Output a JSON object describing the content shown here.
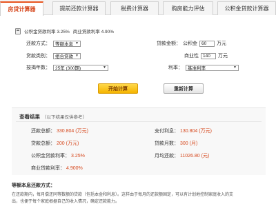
{
  "tabs": [
    {
      "label": "房贷计算器"
    },
    {
      "label": "提前还款计算器"
    },
    {
      "label": "税费计算器"
    },
    {
      "label": "购房能力评估"
    },
    {
      "label": "公积金贷款计算器"
    }
  ],
  "rates": {
    "fund_label": "公积金贷款利率",
    "fund_value": "3.25%",
    "commercial_label": "商业贷款利率",
    "commercial_value": "4.90%"
  },
  "form": {
    "repay_method_label": "还款方式：",
    "repay_method_value": "等额本息",
    "loan_type_label": "贷款类别：",
    "loan_type_value": "组合贷款",
    "years_label": "按揭年数：",
    "years_value": "25年 (300期)",
    "loan_amount_label": "贷款金额：",
    "fund_part_label": "公积金",
    "fund_part_value": "60",
    "fund_part_unit": "万元",
    "commercial_part_label": "商业性",
    "commercial_part_value": "140",
    "commercial_part_unit": "万元",
    "rate_label": "利率：",
    "rate_value": "基准利率"
  },
  "buttons": {
    "calculate": "开始计算",
    "reset": "重新计算"
  },
  "result": {
    "title": "查看结果",
    "note": "（以下结果仅供参考）",
    "total_repay_label": "还款总额：",
    "total_repay_value": "330.804 (万元)",
    "interest_label": "支付利息：",
    "interest_value": "130.804 (万元)",
    "loan_total_label": "贷款总额：",
    "loan_total_value": "200 (万元)",
    "months_label": "贷款月数：",
    "months_value": "300 (月)",
    "fund_rate_label": "公积金贷款利率：",
    "fund_rate_value": "3.25%",
    "monthly_label": "月均还款：",
    "monthly_value": "11026.80 (元)",
    "commercial_rate_label": "商业贷款利率：",
    "commercial_rate_value": "4.900%"
  },
  "method": {
    "title": "等额本息还款方式：",
    "line1": "在还款期内，每月偿还同等数额的贷款（包括本金和利息）。这样由于每月的还款额固定，可以有计划地控制家庭收入的支",
    "line2": "出，也便于每个家庭根据自己的收入情况，确定还款能力。"
  },
  "colors": {
    "accent": "#d6471c",
    "button_yellow": "#f5b400"
  }
}
